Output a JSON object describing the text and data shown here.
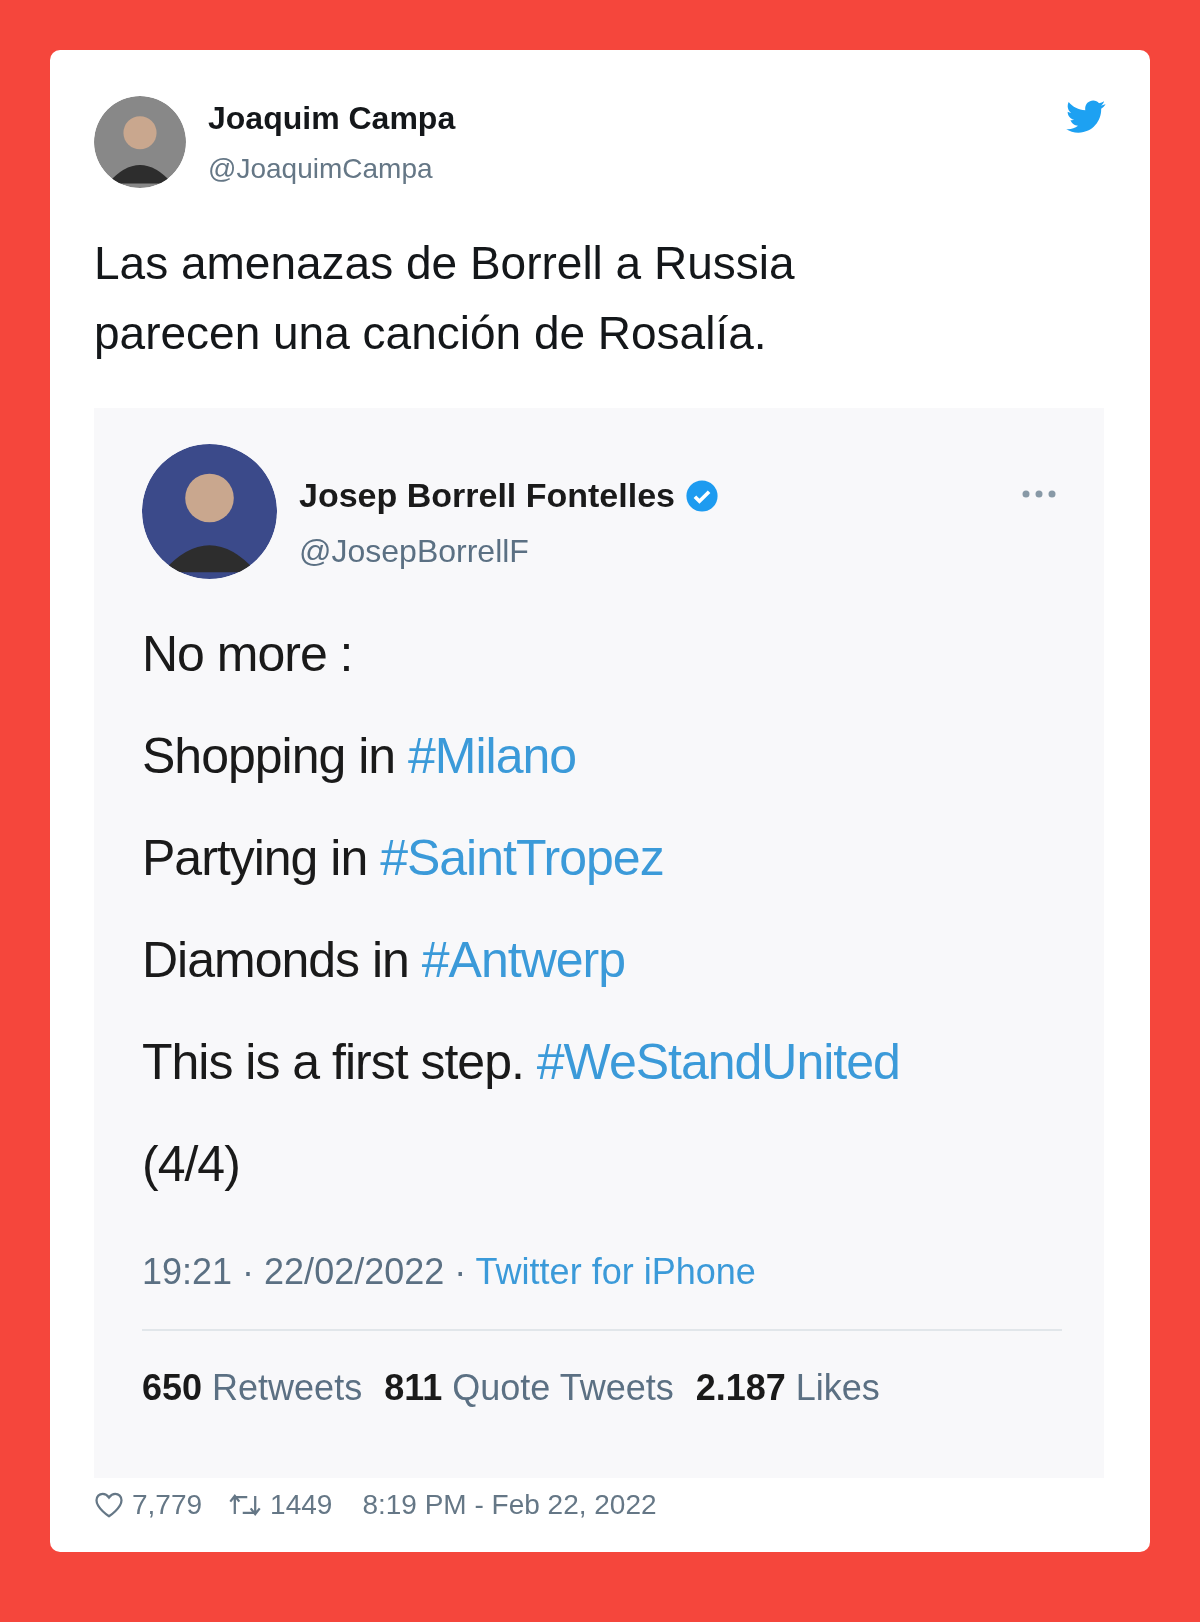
{
  "tweet": {
    "author": {
      "name": "Joaquim Campa",
      "handle": "@JoaquimCampa"
    },
    "text": "Las amenazas de Borrell a Russia parecen una canción de Rosalía.",
    "quoted": {
      "author": {
        "name": "Josep Borrell Fontelles",
        "handle": "@JosepBorrellF",
        "verified": true
      },
      "lines": [
        {
          "text": "No more :"
        },
        {
          "text": "Shopping in ",
          "hashtag": "#Milano"
        },
        {
          "text": "Partying in ",
          "hashtag": "#SaintTropez"
        },
        {
          "text": "Diamonds in ",
          "hashtag": "#Antwerp"
        },
        {
          "text": "This is a first step. ",
          "hashtag": "#WeStandUnited"
        },
        {
          "text": "(4/4)"
        }
      ],
      "timestamp": "19:21 · 22/02/2022 · ",
      "source": "Twitter for iPhone",
      "stats": [
        "**650** Retweets",
        "**811** Quote Tweets",
        "**2.187** Likes"
      ]
    },
    "likes": "7,779",
    "retweets": "1449",
    "date": "8:19 PM - Feb 22, 2022"
  }
}
